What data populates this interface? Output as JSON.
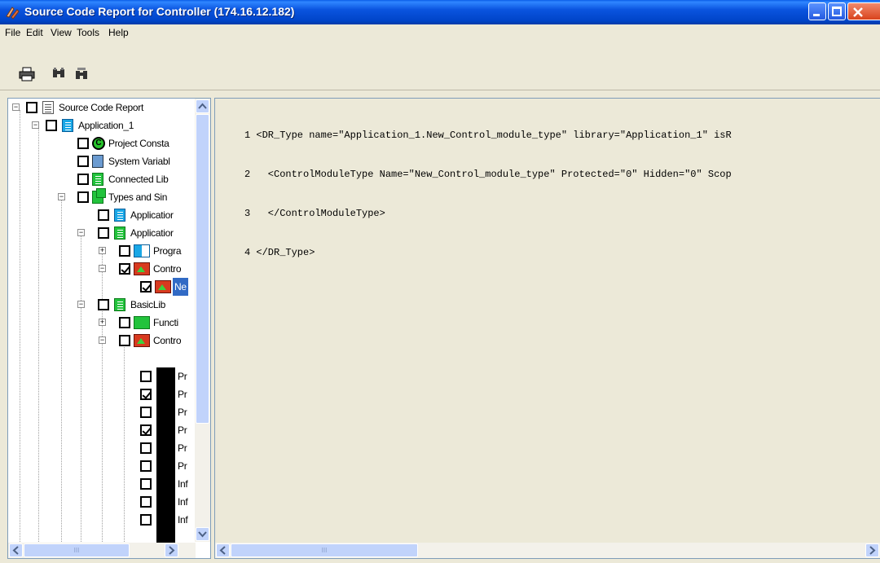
{
  "window": {
    "title": "Source Code Report for Controller (174.16.12.182)"
  },
  "menu": [
    "File",
    "Edit",
    "View",
    "Tools",
    "Help"
  ],
  "toolbar": {
    "icons": [
      "printer-icon",
      "find-icon",
      "find-replace-icon"
    ]
  },
  "tree": {
    "items": [
      {
        "label": "Source Code Report"
      },
      {
        "label": "Application_1"
      },
      {
        "label": "Project Consta"
      },
      {
        "label": "System Variabl"
      },
      {
        "label": "Connected Lib"
      },
      {
        "label": "Types and Sin"
      },
      {
        "label": "Applicatior"
      },
      {
        "label": "Applicatior"
      },
      {
        "label": "Progra"
      },
      {
        "label": "Contro"
      },
      {
        "label": "Ne"
      },
      {
        "label": "BasicLib"
      },
      {
        "label": "Functi"
      },
      {
        "label": "Contro"
      },
      {
        "label": "Pr"
      },
      {
        "label": "Pr"
      },
      {
        "label": "Pr"
      },
      {
        "label": "Pr"
      },
      {
        "label": "Pr"
      },
      {
        "label": "Pr"
      },
      {
        "label": "Inf"
      },
      {
        "label": "Inf"
      },
      {
        "label": "Inf"
      }
    ]
  },
  "code": {
    "lines": [
      "1 <DR_Type name=\"Application_1.New_Control_module_type\" library=\"Application_1\" isR",
      "2   <ControlModuleType Name=\"New_Control_module_type\" Protected=\"0\" Hidden=\"0\" Scop",
      "3   </ControlModuleType>",
      "4 </DR_Type>"
    ]
  },
  "scrollbars": {
    "left_h_grip": "III",
    "right_h_grip": "III"
  }
}
